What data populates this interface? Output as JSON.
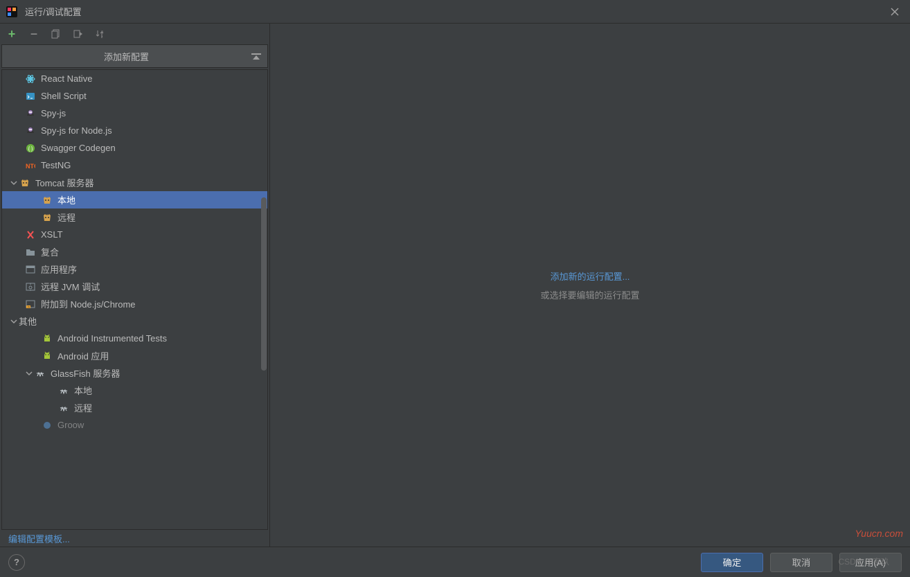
{
  "title": "运行/调试配置",
  "header": {
    "add_new_label": "添加新配置"
  },
  "tree": {
    "items": [
      {
        "label": "React Native",
        "icon": "react",
        "indent": 1,
        "group": false
      },
      {
        "label": "Shell Script",
        "icon": "shell",
        "indent": 1,
        "group": false
      },
      {
        "label": "Spy-js",
        "icon": "spyjs",
        "indent": 1,
        "group": false
      },
      {
        "label": "Spy-js for Node.js",
        "icon": "spyjs",
        "indent": 1,
        "group": false
      },
      {
        "label": "Swagger Codegen",
        "icon": "swagger",
        "indent": 1,
        "group": false
      },
      {
        "label": "TestNG",
        "icon": "testng",
        "indent": 1,
        "group": false
      },
      {
        "label": "Tomcat 服务器",
        "icon": "tomcat",
        "indent": 0,
        "group": true,
        "expanded": true
      },
      {
        "label": "本地",
        "icon": "tomcat",
        "indent": 2,
        "group": false,
        "selected": true
      },
      {
        "label": "远程",
        "icon": "tomcat",
        "indent": 2,
        "group": false
      },
      {
        "label": "XSLT",
        "icon": "xslt",
        "indent": 1,
        "group": false
      },
      {
        "label": "复合",
        "icon": "folder",
        "indent": 1,
        "group": false
      },
      {
        "label": "应用程序",
        "icon": "app",
        "indent": 1,
        "group": false
      },
      {
        "label": "远程 JVM 调试",
        "icon": "jvm",
        "indent": 1,
        "group": false
      },
      {
        "label": "附加到 Node.js/Chrome",
        "icon": "nodejs",
        "indent": 1,
        "group": false
      },
      {
        "label": "其他",
        "icon": "",
        "indent": 0,
        "group": true,
        "expanded": true
      },
      {
        "label": "Android Instrumented Tests",
        "icon": "android",
        "indent": 2,
        "group": false
      },
      {
        "label": "Android 应用",
        "icon": "android",
        "indent": 2,
        "group": false
      },
      {
        "label": "GlassFish 服务器",
        "icon": "glassfish",
        "indent": 1,
        "group": true,
        "expanded": true
      },
      {
        "label": "本地",
        "icon": "glassfish",
        "indent": 3,
        "group": false
      },
      {
        "label": "远程",
        "icon": "glassfish",
        "indent": 3,
        "group": false
      },
      {
        "label": "Groow",
        "icon": "groovy",
        "indent": 2,
        "group": false,
        "faded": true
      }
    ]
  },
  "sidebar": {
    "edit_templates": "编辑配置模板..."
  },
  "main": {
    "link": "添加新的运行配置...",
    "text": "或选择要编辑的运行配置"
  },
  "footer": {
    "ok": "确定",
    "cancel": "取消",
    "apply": "应用(A)"
  },
  "watermarks": {
    "w1": "Yuucn.com",
    "w2": "CSDN @宇玖"
  },
  "icon_colors": {
    "react": "#61dafb",
    "shell": "#3592c4",
    "spyjs": "#9b7cb8",
    "swagger": "#6cb33e",
    "testng": "#f26522",
    "tomcat": "#d6a24d",
    "xslt": "#f55353",
    "folder": "#87939a",
    "app": "#87939a",
    "jvm": "#87939a",
    "nodejs": "#f0a732",
    "android": "#a4c639",
    "glassfish": "#cfd6db",
    "groovy": "#5c98d6"
  }
}
